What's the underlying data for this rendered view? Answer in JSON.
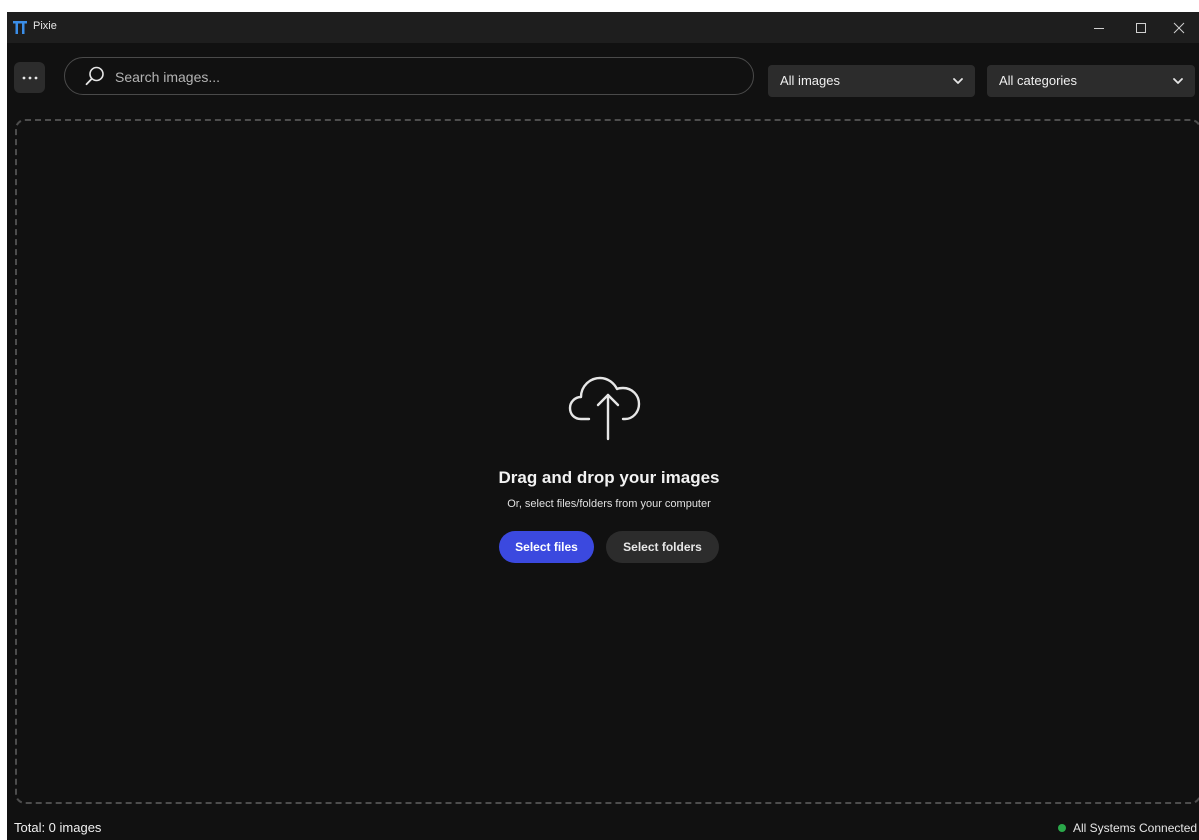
{
  "window": {
    "title": "Pixie"
  },
  "toolbar": {
    "search_placeholder": "Search images...",
    "filter_images": "All images",
    "filter_categories": "All categories"
  },
  "dropzone": {
    "title": "Drag and drop your images",
    "subtitle": "Or, select files/folders from your computer",
    "select_files_label": "Select files",
    "select_folders_label": "Select folders"
  },
  "statusbar": {
    "total": "Total: 0 images",
    "connection": "All Systems Connected"
  },
  "colors": {
    "background": "#111111",
    "titlebar": "#1e1e1e",
    "accent": "#3b49df",
    "status_ok": "#2aa84a"
  },
  "icons": {
    "logo": "pi-logo-icon",
    "more": "more-dots-icon",
    "search": "search-icon",
    "chevron": "chevron-down-icon",
    "upload": "cloud-upload-icon"
  }
}
